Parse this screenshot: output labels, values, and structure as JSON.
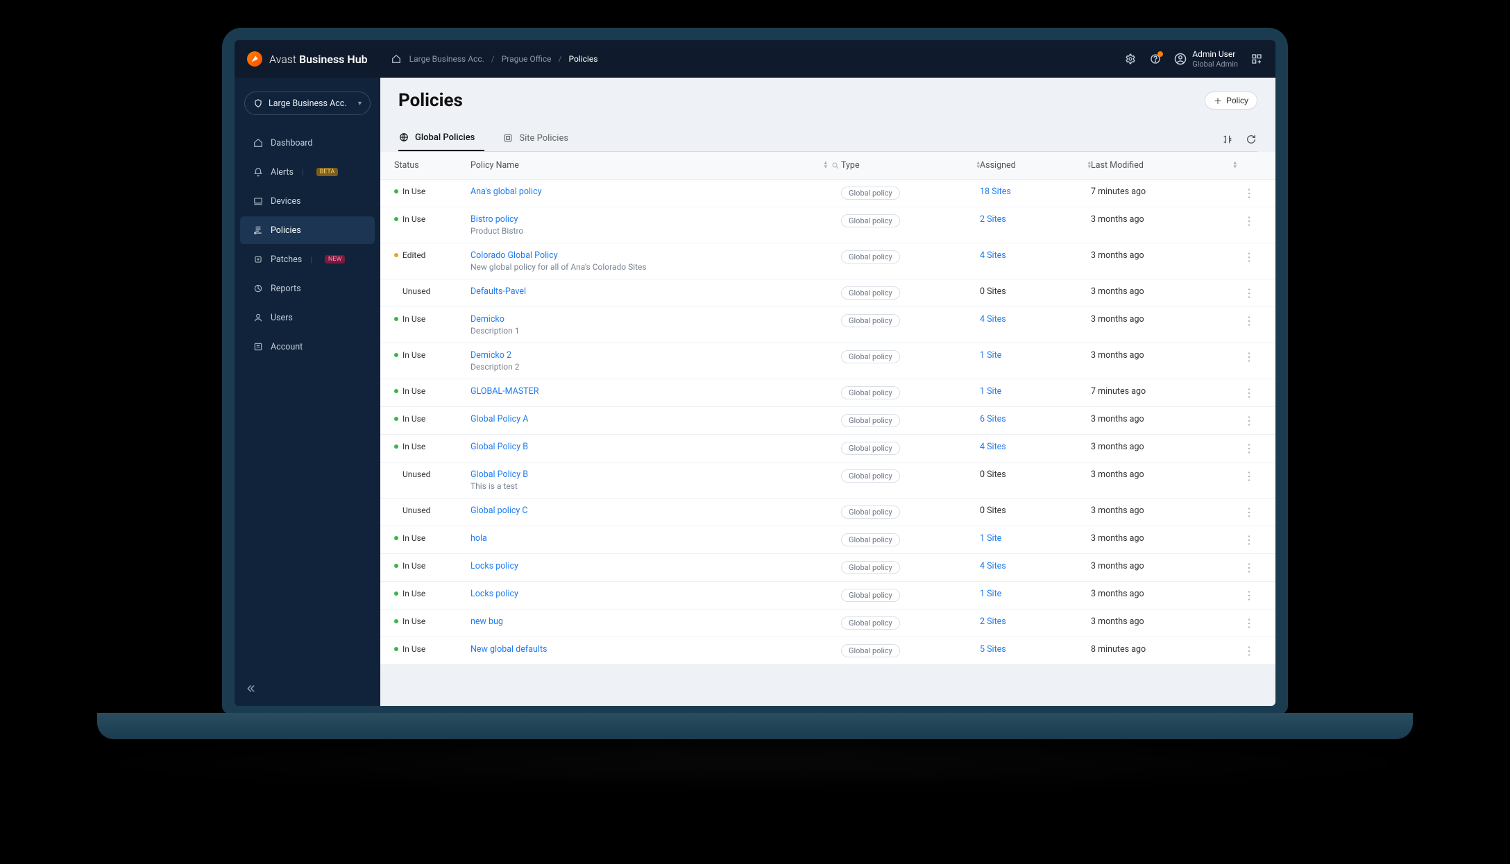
{
  "brand": {
    "text1": "Avast",
    "text2": "Business Hub"
  },
  "breadcrumbs": {
    "root": "Large Business Acc.",
    "mid": "Prague Office",
    "cur": "Policies"
  },
  "user": {
    "name": "Admin User",
    "role": "Global Admin"
  },
  "account_selector": "Large Business Acc.",
  "sidebar": {
    "items": [
      {
        "label": "Dashboard"
      },
      {
        "label": "Alerts",
        "tag": "BETA",
        "tagClass": "tag-beta"
      },
      {
        "label": "Devices"
      },
      {
        "label": "Policies",
        "active": true
      },
      {
        "label": "Patches",
        "tag": "NEW",
        "tagClass": "tag-new"
      },
      {
        "label": "Reports"
      },
      {
        "label": "Users"
      },
      {
        "label": "Account"
      }
    ]
  },
  "page": {
    "title": "Policies",
    "add_button": "Policy",
    "tabs": [
      {
        "label": "Global Policies",
        "active": true
      },
      {
        "label": "Site Policies",
        "active": false
      }
    ]
  },
  "columns": {
    "status": "Status",
    "name": "Policy Name",
    "type": "Type",
    "assigned": "Assigned",
    "modified": "Last Modified"
  },
  "rows": [
    {
      "status": "In Use",
      "dot": "green",
      "name": "Ana's global policy",
      "desc": "",
      "type": "Global policy",
      "assigned": "18 Sites",
      "assigned_link": true,
      "modified": "7 minutes ago"
    },
    {
      "status": "In Use",
      "dot": "green",
      "name": "Bistro policy",
      "desc": "Product Bistro",
      "type": "Global policy",
      "assigned": "2 Sites",
      "assigned_link": true,
      "modified": "3 months ago"
    },
    {
      "status": "Edited",
      "dot": "amber",
      "name": "Colorado Global Policy",
      "desc": "New global policy for all of Ana's Colorado Sites",
      "type": "Global policy",
      "assigned": "4 Sites",
      "assigned_link": true,
      "modified": "3 months ago"
    },
    {
      "status": "Unused",
      "dot": "",
      "name": "Defaults-Pavel",
      "desc": "",
      "type": "Global policy",
      "assigned": "0 Sites",
      "assigned_link": false,
      "modified": "3 months ago"
    },
    {
      "status": "In Use",
      "dot": "green",
      "name": "Demicko",
      "desc": "Description 1",
      "type": "Global policy",
      "assigned": "4 Sites",
      "assigned_link": true,
      "modified": "3 months ago"
    },
    {
      "status": "In Use",
      "dot": "green",
      "name": "Demicko 2",
      "desc": "Description 2",
      "type": "Global policy",
      "assigned": "1 Site",
      "assigned_link": true,
      "modified": "3 months ago"
    },
    {
      "status": "In Use",
      "dot": "green",
      "name": "GLOBAL-MASTER",
      "desc": "",
      "type": "Global policy",
      "assigned": "1 Site",
      "assigned_link": true,
      "modified": "7 minutes ago"
    },
    {
      "status": "In Use",
      "dot": "green",
      "name": "Global Policy A",
      "desc": "",
      "type": "Global policy",
      "assigned": "6 Sites",
      "assigned_link": true,
      "modified": "3 months ago"
    },
    {
      "status": "In Use",
      "dot": "green",
      "name": "Global Policy B",
      "desc": "",
      "type": "Global policy",
      "assigned": "4 Sites",
      "assigned_link": true,
      "modified": "3 months ago"
    },
    {
      "status": "Unused",
      "dot": "",
      "name": "Global Policy B",
      "desc": "This is a test",
      "type": "Global policy",
      "assigned": "0 Sites",
      "assigned_link": false,
      "modified": "3 months ago"
    },
    {
      "status": "Unused",
      "dot": "",
      "name": "Global policy C",
      "desc": "",
      "type": "Global policy",
      "assigned": "0 Sites",
      "assigned_link": false,
      "modified": "3 months ago"
    },
    {
      "status": "In Use",
      "dot": "green",
      "name": "hola",
      "desc": "",
      "type": "Global policy",
      "assigned": "1 Site",
      "assigned_link": true,
      "modified": "3 months ago"
    },
    {
      "status": "In Use",
      "dot": "green",
      "name": "Locks policy",
      "desc": "",
      "type": "Global policy",
      "assigned": "4 Sites",
      "assigned_link": true,
      "modified": "3 months ago"
    },
    {
      "status": "In Use",
      "dot": "green",
      "name": "Locks policy",
      "desc": "",
      "type": "Global policy",
      "assigned": "1 Site",
      "assigned_link": true,
      "modified": "3 months ago"
    },
    {
      "status": "In Use",
      "dot": "green",
      "name": "new bug",
      "desc": "",
      "type": "Global policy",
      "assigned": "2 Sites",
      "assigned_link": true,
      "modified": "3 months ago"
    },
    {
      "status": "In Use",
      "dot": "green",
      "name": "New global defaults",
      "desc": "",
      "type": "Global policy",
      "assigned": "5 Sites",
      "assigned_link": true,
      "modified": "8 minutes ago"
    }
  ]
}
